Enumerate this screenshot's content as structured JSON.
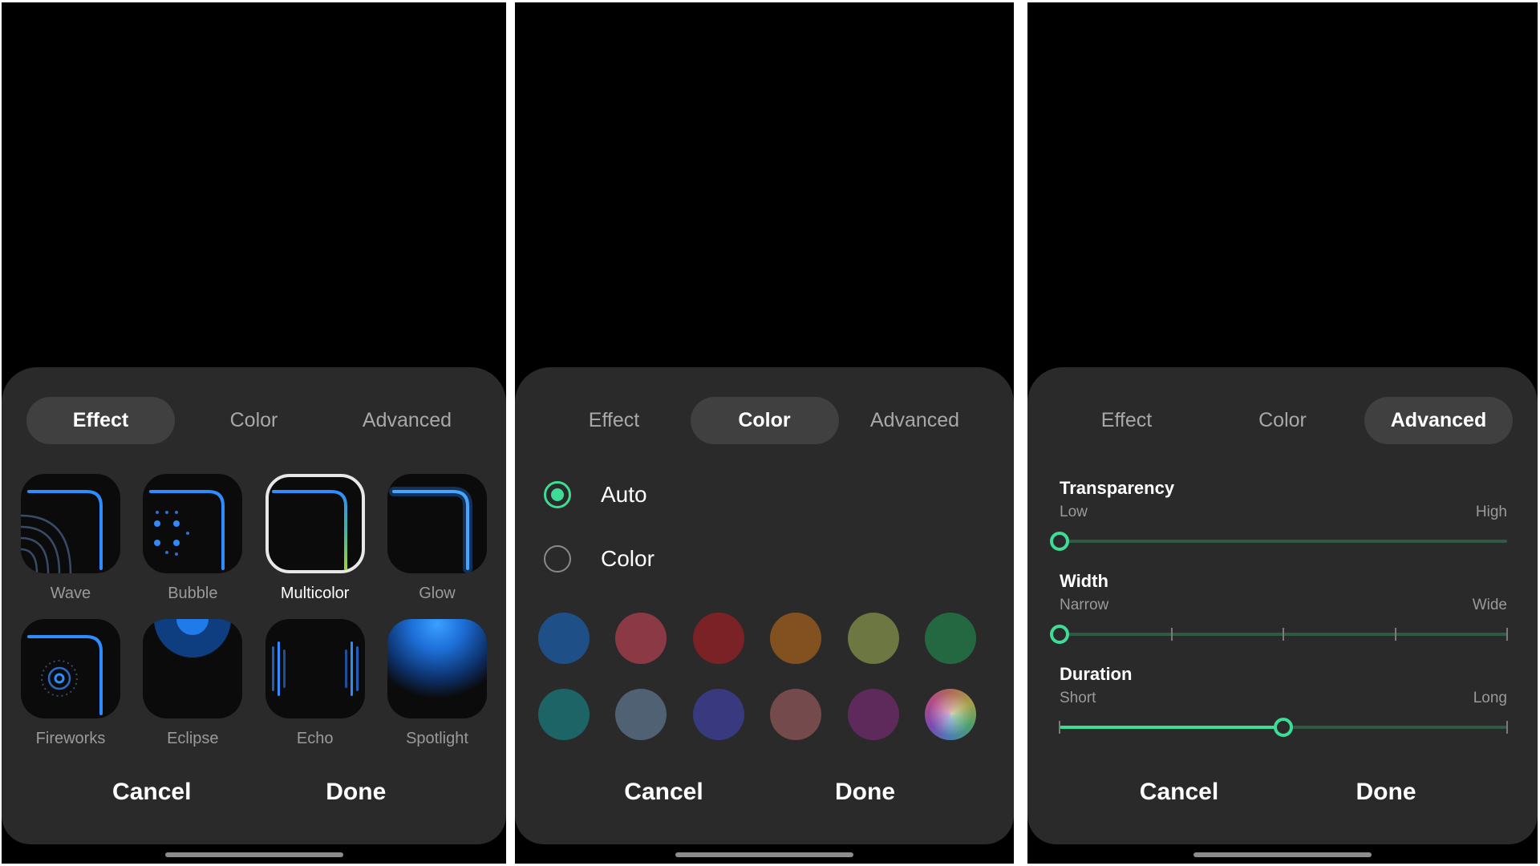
{
  "tabs": {
    "effect": "Effect",
    "color": "Color",
    "advanced": "Advanced"
  },
  "actions": {
    "cancel": "Cancel",
    "done": "Done"
  },
  "effect_panel": {
    "selected": "Multicolor",
    "items": [
      {
        "label": "Wave",
        "icon": "wave-icon"
      },
      {
        "label": "Bubble",
        "icon": "bubble-icon"
      },
      {
        "label": "Multicolor",
        "icon": "multicolor-icon"
      },
      {
        "label": "Glow",
        "icon": "glow-icon"
      },
      {
        "label": "Fireworks",
        "icon": "fireworks-icon"
      },
      {
        "label": "Eclipse",
        "icon": "eclipse-icon"
      },
      {
        "label": "Echo",
        "icon": "echo-icon"
      },
      {
        "label": "Spotlight",
        "icon": "spotlight-icon"
      }
    ]
  },
  "color_panel": {
    "options": [
      {
        "label": "Auto",
        "checked": true
      },
      {
        "label": "Color",
        "checked": false
      }
    ],
    "swatches": [
      "#1e4f86",
      "#8c3946",
      "#7a2226",
      "#83501f",
      "#6c7741",
      "#246841",
      "#1d6466",
      "#4f6172",
      "#38397f",
      "#744a4c",
      "#5e2a5c",
      "conic"
    ]
  },
  "advanced_panel": {
    "sliders": [
      {
        "title": "Transparency",
        "min_label": "Low",
        "max_label": "High",
        "value": 0,
        "steps": 0,
        "filled": false
      },
      {
        "title": "Width",
        "min_label": "Narrow",
        "max_label": "Wide",
        "value": 0,
        "steps": 4,
        "filled": false
      },
      {
        "title": "Duration",
        "min_label": "Short",
        "max_label": "Long",
        "value": 0.5,
        "steps": 2,
        "filled": true
      }
    ]
  },
  "colors": {
    "accent": "#3ddc97",
    "sheet": "#2a2a2a",
    "tab_selected": "#404040"
  }
}
